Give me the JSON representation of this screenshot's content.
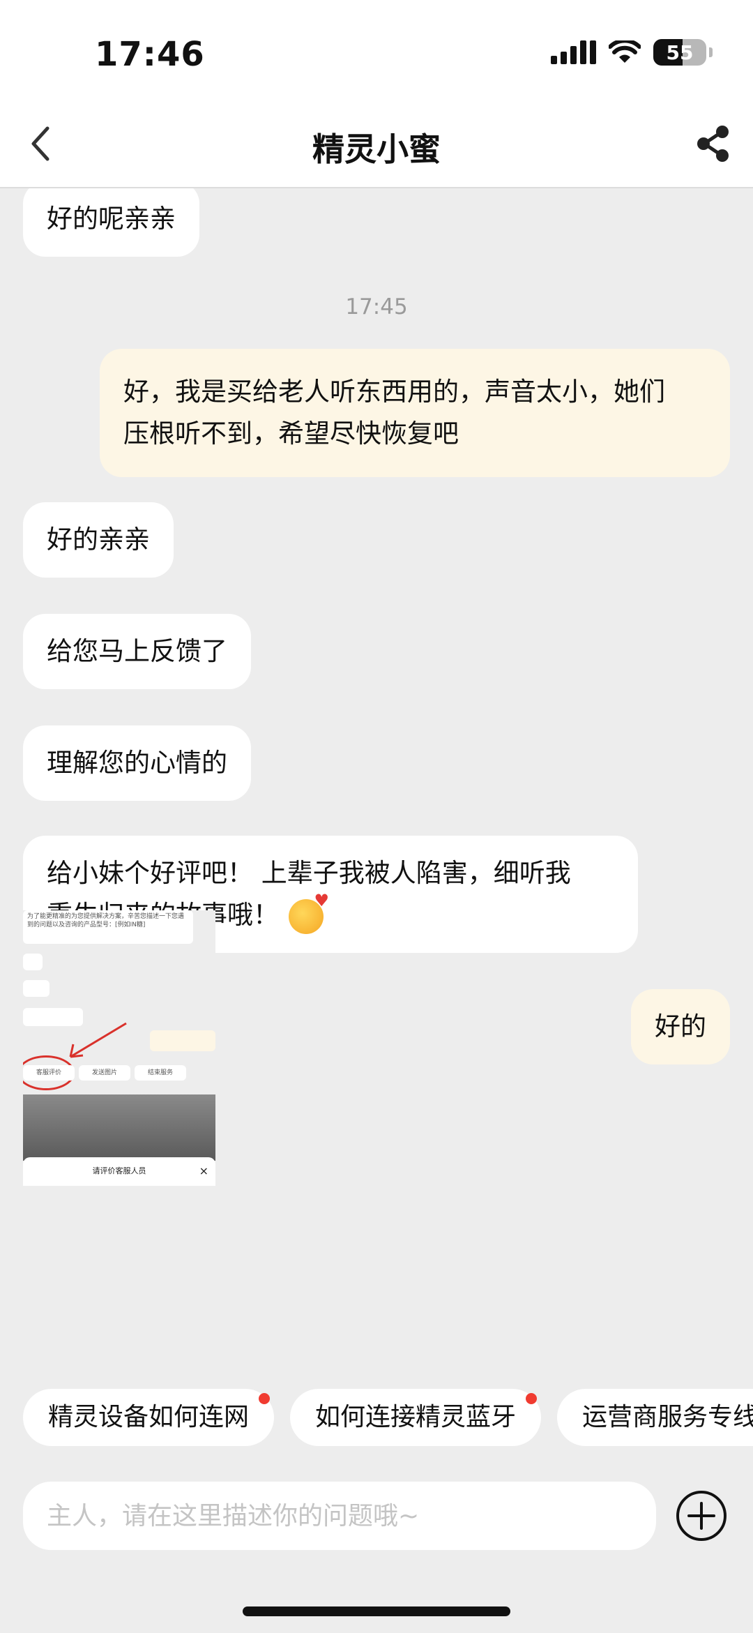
{
  "status_bar": {
    "time": "17:46",
    "battery": "55",
    "battery_level": 0.55
  },
  "header": {
    "title": "精灵小蜜"
  },
  "messages": [
    {
      "side": "in",
      "lines": [
        "好的呢亲亲"
      ]
    },
    {
      "side": "time",
      "text": "17:45"
    },
    {
      "side": "out",
      "lines": [
        "好，我是买给老人听东西用的，声音太小，她们",
        "压根听不到，希望尽快恢复吧"
      ]
    },
    {
      "side": "in",
      "lines": [
        "好的亲亲"
      ]
    },
    {
      "side": "in",
      "lines": [
        "给您马上反馈了"
      ]
    },
    {
      "side": "in",
      "lines": [
        "理解您的心情的"
      ]
    },
    {
      "side": "in",
      "lines": [
        "给小妹个好评吧！ 上辈子我被人陷害，细听我",
        "重生归来的故事哦！"
      ],
      "emoji": "blushing-kiss-emoji"
    },
    {
      "side": "out",
      "lines": [
        "好的"
      ]
    }
  ],
  "thumbnail": {
    "intro_text": "为了能更精准的为您提供解决方案，辛苦您描述一下您遇到的问题以及咨询的产品型号：[例如IN糖]",
    "buttons": [
      "客服评价",
      "发送图片",
      "结束服务"
    ],
    "sheet_title": "请评价客服人员",
    "sheet_close": "×"
  },
  "quick_chips": [
    {
      "label": "精灵设备如何连网",
      "dot": true
    },
    {
      "label": "如何连接精灵蓝牙",
      "dot": true
    },
    {
      "label": "运营商服务专线",
      "dot": false
    }
  ],
  "input": {
    "placeholder": "主人，请在这里描述你的问题哦~"
  },
  "icons": {
    "back": "chevron-left-icon",
    "share": "share-icon",
    "plus": "plus-circle-icon"
  },
  "colors": {
    "bg": "#ededed",
    "incoming": "#ffffff",
    "outgoing": "#fdf6e5",
    "badge_dot": "#f03b30"
  }
}
